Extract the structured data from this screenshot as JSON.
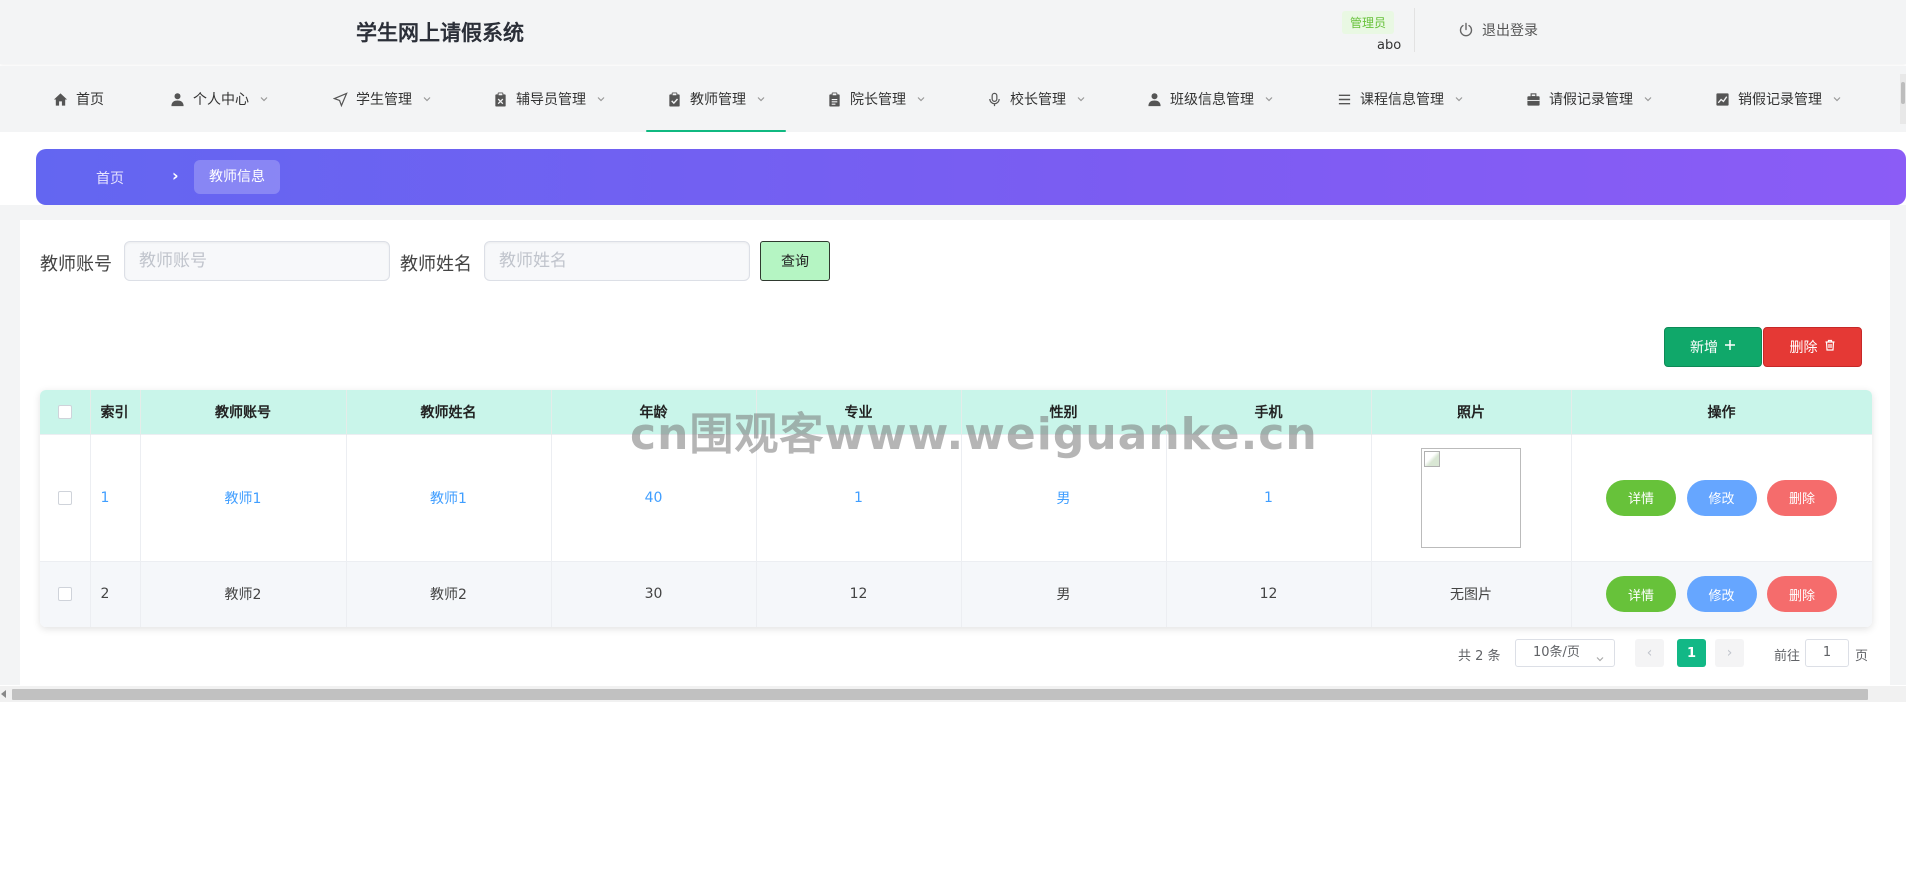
{
  "header": {
    "app_title": "学生网上请假系统",
    "role_badge": "管理员",
    "username": "abo",
    "logout_label": "退出登录"
  },
  "nav": {
    "items": [
      {
        "label": "首页",
        "icon": "home-icon"
      },
      {
        "label": "个人中心",
        "icon": "user-icon"
      },
      {
        "label": "学生管理",
        "icon": "send-icon"
      },
      {
        "label": "辅导员管理",
        "icon": "clipboard-x-icon"
      },
      {
        "label": "教师管理",
        "icon": "clipboard-check-icon"
      },
      {
        "label": "院长管理",
        "icon": "clipboard-list-icon"
      },
      {
        "label": "校长管理",
        "icon": "microphone-icon"
      },
      {
        "label": "班级信息管理",
        "icon": "user-icon"
      },
      {
        "label": "课程信息管理",
        "icon": "list-icon"
      },
      {
        "label": "请假记录管理",
        "icon": "briefcase-icon"
      },
      {
        "label": "销假记录管理",
        "icon": "chart-icon"
      }
    ],
    "active_index": 4
  },
  "breadcrumb": {
    "home": "首页",
    "separator": "›",
    "current": "教师信息"
  },
  "search": {
    "account_label": "教师账号",
    "account_placeholder": "教师账号",
    "name_label": "教师姓名",
    "name_placeholder": "教师姓名",
    "query_label": "查询"
  },
  "actions": {
    "add_label": "新增",
    "delete_label": "删除"
  },
  "table": {
    "headers": [
      "索引",
      "教师账号",
      "教师姓名",
      "年龄",
      "专业",
      "性别",
      "手机",
      "照片",
      "操作"
    ],
    "rows": [
      {
        "index": "1",
        "account": "教师1",
        "name": "教师1",
        "age": "40",
        "major": "1",
        "gender": "男",
        "phone": "1",
        "photo": ""
      },
      {
        "index": "2",
        "account": "教师2",
        "name": "教师2",
        "age": "30",
        "major": "12",
        "gender": "男",
        "phone": "12",
        "photo": "无图片"
      }
    ],
    "op_detail": "详情",
    "op_edit": "修改",
    "op_delete": "删除"
  },
  "pagination": {
    "total": "共 2 条",
    "page_size": "10条/页",
    "current_page": "1",
    "goto_prefix": "前往",
    "goto_value": "1",
    "goto_suffix": "页"
  },
  "watermark": "cn围观客www.weiguanke.cn",
  "colors": {
    "accent": "#10b981",
    "banner_start": "#6366f1",
    "banner_end": "#8b5cf6",
    "table_header": "#c9f5ea",
    "link_blue": "#409eff"
  }
}
